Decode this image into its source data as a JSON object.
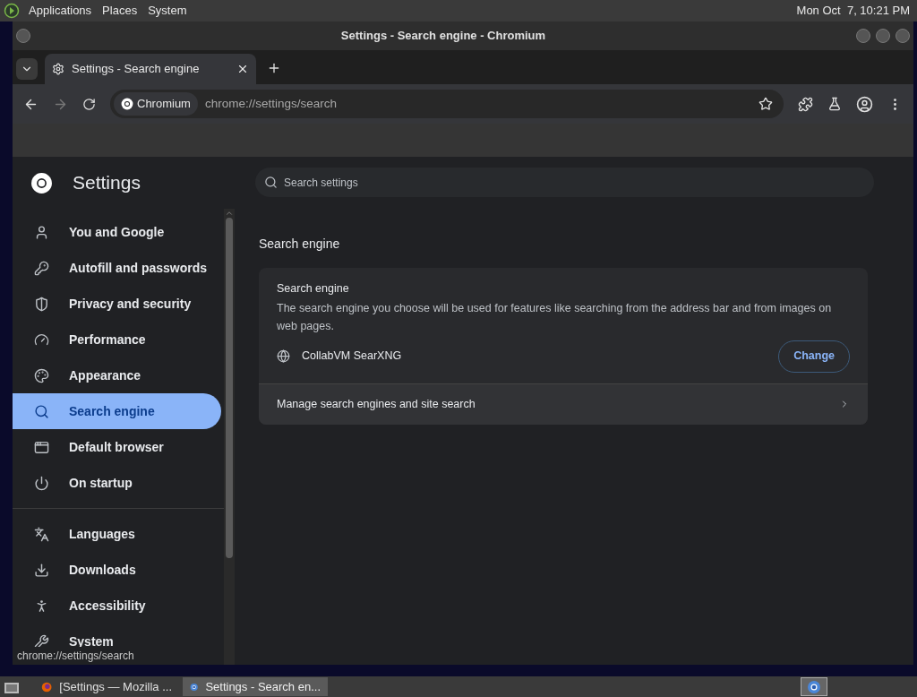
{
  "top_panel": {
    "menus": [
      "Applications",
      "Places",
      "System"
    ],
    "clock": "Mon Oct  7, 10:21 PM"
  },
  "window": {
    "title": "Settings - Search engine - Chromium"
  },
  "tabs": [
    {
      "label": "Settings - Search engine",
      "selected": true
    }
  ],
  "toolbar": {
    "site_chip": "Chromium",
    "url": "chrome://settings/search"
  },
  "settings": {
    "title": "Settings",
    "search": {
      "placeholder": "Search settings"
    },
    "nav_groups": [
      [
        {
          "label": "You and Google",
          "selected": false
        },
        {
          "label": "Autofill and passwords",
          "selected": false
        },
        {
          "label": "Privacy and security",
          "selected": false
        },
        {
          "label": "Performance",
          "selected": false
        },
        {
          "label": "Appearance",
          "selected": false
        },
        {
          "label": "Search engine",
          "selected": true
        },
        {
          "label": "Default browser",
          "selected": false
        },
        {
          "label": "On startup",
          "selected": false
        }
      ],
      [
        {
          "label": "Languages",
          "selected": false
        },
        {
          "label": "Downloads",
          "selected": false
        },
        {
          "label": "Accessibility",
          "selected": false
        },
        {
          "label": "System",
          "selected": false
        }
      ]
    ],
    "section_title": "Search engine",
    "card": {
      "title": "Search engine",
      "description": "The search engine you choose will be used for features like searching from the address bar and from images on web pages.",
      "engine": "CollabVM SearXNG",
      "change_button": "Change",
      "manage_link": "Manage search engines and site search"
    }
  },
  "status_bubble": "chrome://settings/search",
  "taskbar": [
    {
      "label": "[Settings — Mozilla ...",
      "selected": false
    },
    {
      "label": "Settings - Search en...",
      "selected": true
    }
  ]
}
